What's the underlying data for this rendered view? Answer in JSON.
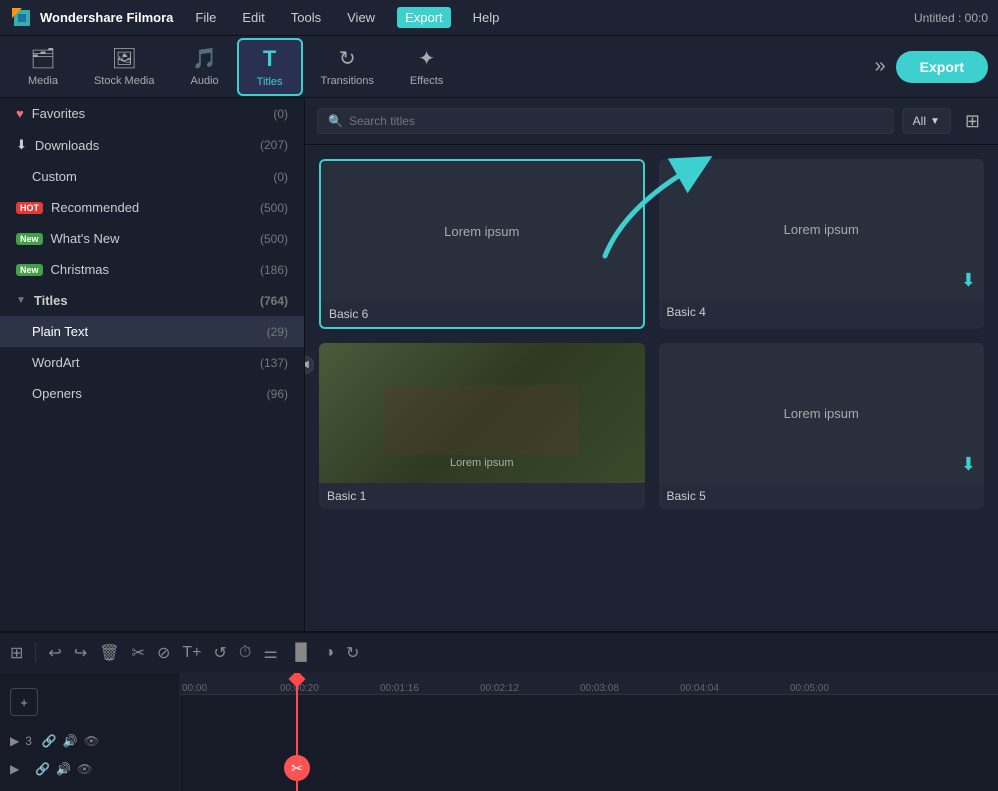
{
  "app": {
    "name": "Wondershare Filmora",
    "title_right": "Untitled : 00:0"
  },
  "menu": {
    "items": [
      "File",
      "Edit",
      "Tools",
      "View",
      "Export",
      "Help"
    ],
    "active": "Export"
  },
  "toolbar": {
    "export_label": "Export",
    "items": [
      {
        "id": "media",
        "label": "Media",
        "icon": "🗂"
      },
      {
        "id": "stock-media",
        "label": "Stock Media",
        "icon": "🖼"
      },
      {
        "id": "audio",
        "label": "Audio",
        "icon": "🎵"
      },
      {
        "id": "titles",
        "label": "Titles",
        "icon": "T"
      },
      {
        "id": "transitions",
        "label": "Transitions",
        "icon": "↻"
      },
      {
        "id": "effects",
        "label": "Effects",
        "icon": "✦"
      }
    ],
    "active": "titles",
    "more_icon": "»"
  },
  "sidebar": {
    "items": [
      {
        "id": "favorites",
        "label": "Favorites",
        "count": "(0)",
        "icon": "♥"
      },
      {
        "id": "downloads",
        "label": "Downloads",
        "count": "(207)",
        "icon": "⬇"
      },
      {
        "id": "custom",
        "label": "Custom",
        "count": "(0)",
        "indent": true
      },
      {
        "id": "recommended",
        "label": "Recommended",
        "count": "(500)",
        "badge": "HOT"
      },
      {
        "id": "whats-new",
        "label": "What's New",
        "count": "(500)",
        "badge": "NEW"
      },
      {
        "id": "christmas",
        "label": "Christmas",
        "count": "(186)",
        "badge": "NEW"
      },
      {
        "id": "titles-section",
        "label": "Titles",
        "count": "(764)",
        "section": true
      },
      {
        "id": "plain-text",
        "label": "Plain Text",
        "count": "(29)",
        "active": true,
        "indent": true
      },
      {
        "id": "wordart",
        "label": "WordArt",
        "count": "(137)",
        "indent": true
      },
      {
        "id": "openers",
        "label": "Openers",
        "count": "(96)",
        "indent": true
      }
    ]
  },
  "content": {
    "search_placeholder": "Search titles",
    "filter_label": "All",
    "tiles": [
      {
        "id": "basic6",
        "label": "Basic 6",
        "text": "Lorem ipsum",
        "selected": true,
        "has_download": false
      },
      {
        "id": "basic4",
        "label": "Basic 4",
        "text": "Lorem ipsum",
        "selected": false,
        "has_download": true
      },
      {
        "id": "basic1",
        "label": "Basic 1",
        "text": "",
        "selected": false,
        "has_download": false,
        "vineyard": true
      },
      {
        "id": "basic5",
        "label": "Basic 5",
        "text": "Lorem ipsum",
        "selected": false,
        "has_download": true
      }
    ]
  },
  "timeline": {
    "toolbar_icons": [
      "⊞",
      "|",
      "↩",
      "↪",
      "🗑",
      "✂",
      "⊘",
      "T+",
      "↺",
      "⏱",
      "⚌",
      "▐▌",
      "◑",
      "↻"
    ],
    "ruler_marks": [
      "00:00",
      "00:00:20",
      "00:01:16",
      "00:02:12",
      "00:03:08",
      "00:04:04",
      "00:05:00"
    ],
    "playhead_position": "00:00:20",
    "tracks": [
      {
        "icon": "▶",
        "num": "3",
        "extra_icons": [
          "🔒",
          "🔊",
          "👁"
        ]
      }
    ]
  }
}
